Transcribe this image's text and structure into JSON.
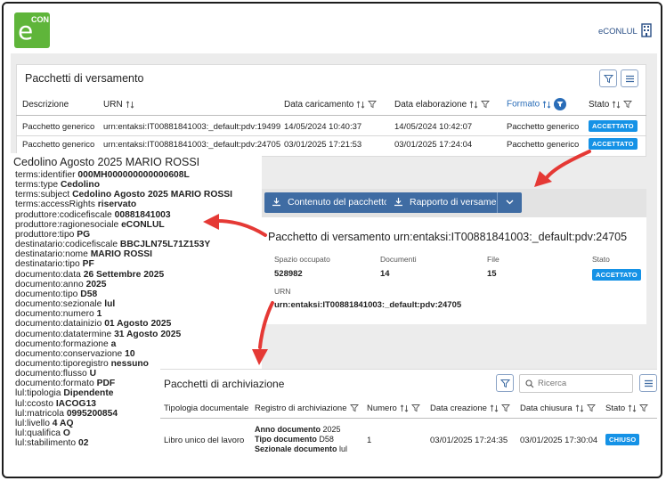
{
  "header": {
    "logo_letter": "e",
    "logo_text": "CON",
    "user": "eCONLUL"
  },
  "versamento": {
    "title": "Pacchetti di versamento",
    "columns": [
      "Descrizione",
      "URN",
      "Data caricamento",
      "Data elaborazione",
      "Formato",
      "Stato"
    ],
    "rows": [
      {
        "descrizione": "Pacchetto generico",
        "urn": "urn:entaksi:IT00881841003:_default:pdv:19499",
        "data_caricamento": "14/05/2024 10:40:37",
        "data_elaborazione": "14/05/2024 10:42:07",
        "formato": "Pacchetto generico",
        "stato": "ACCETTATO"
      },
      {
        "descrizione": "Pacchetto generico",
        "urn": "urn:entaksi:IT00881841003:_default:pdv:24705",
        "data_caricamento": "03/01/2025 17:21:53",
        "data_elaborazione": "03/01/2025 17:24:04",
        "formato": "Pacchetto generico",
        "stato": "ACCETTATO"
      }
    ]
  },
  "metadata": {
    "title": "Cedolino Agosto 2025 MARIO ROSSI",
    "lines": [
      {
        "key": "terms:identifier",
        "value": "000MH000000000000608L"
      },
      {
        "key": "terms:type",
        "value": "Cedolino"
      },
      {
        "key": "terms:subject",
        "value": "Cedolino Agosto 2025 MARIO ROSSI"
      },
      {
        "key": "terms:accessRights",
        "value": "riservato"
      },
      {
        "key": "produttore:codicefiscale",
        "value": "00881841003"
      },
      {
        "key": "produttore:ragionesociale",
        "value": "eCONLUL"
      },
      {
        "key": "produttore:tipo",
        "value": "PG"
      },
      {
        "key": "destinatario:codicefiscale",
        "value": "BBCJLN75L71Z153Y"
      },
      {
        "key": "destinatario:nome",
        "value": "MARIO ROSSI"
      },
      {
        "key": "destinatario:tipo",
        "value": "PF"
      },
      {
        "key": "documento:data",
        "value": "26 Settembre 2025"
      },
      {
        "key": "documento:anno",
        "value": "2025"
      },
      {
        "key": "documento:tipo",
        "value": "D58"
      },
      {
        "key": "documento:sezionale",
        "value": "lul"
      },
      {
        "key": "documento:numero",
        "value": "1"
      },
      {
        "key": "documento:datainizio",
        "value": "01 Agosto 2025"
      },
      {
        "key": "documento:datatermine",
        "value": "31 Agosto 2025"
      },
      {
        "key": "documento:formazione",
        "value": "a"
      },
      {
        "key": "documento:conservazione",
        "value": "10"
      },
      {
        "key": "documento:tiporegistro",
        "value": "nessuno"
      },
      {
        "key": "documento:flusso",
        "value": "U"
      },
      {
        "key": "documento:formato",
        "value": "PDF"
      },
      {
        "key": "lul:tipologia",
        "value": "Dipendente"
      },
      {
        "key": "lul:ccosto",
        "value": "IACOG13"
      },
      {
        "key": "lul:matricola",
        "value": "0995200854"
      },
      {
        "key": "lul:livello",
        "value": "4 AQ"
      },
      {
        "key": "lul:qualifica",
        "value": "O"
      },
      {
        "key": "lul:stabilimento",
        "value": "02"
      }
    ]
  },
  "detail": {
    "btn_contenuto": "Contenuto del pacchetto",
    "btn_rapporto": "Rapporto di versamento",
    "title": "Pacchetto di versamento urn:entaksi:IT00881841003:_default:pdv:24705",
    "spazio_label": "Spazio occupato",
    "spazio_value": "528982",
    "documenti_label": "Documenti",
    "documenti_value": "14",
    "file_label": "File",
    "file_value": "15",
    "stato_label": "Stato",
    "stato_value": "ACCETTATO",
    "urn_label": "URN",
    "urn_value": "urn:entaksi:IT00881841003:_default:pdv:24705"
  },
  "archiviazione": {
    "title": "Pacchetti di archiviazione",
    "search_placeholder": "Ricerca",
    "columns": [
      "Tipologia documentale",
      "Registro di archiviazione",
      "Numero",
      "Data creazione",
      "Data chiusura",
      "Stato"
    ],
    "row": {
      "tipologia": "Libro unico del lavoro",
      "anno_label": "Anno documento",
      "anno_value": "2025",
      "tipo_label": "Tipo documento",
      "tipo_value": "D58",
      "sezionale_label": "Sezionale documento",
      "sezionale_value": "lul",
      "numero": "1",
      "data_creazione": "03/01/2025 17:24:35",
      "data_chiusura": "03/01/2025 17:30:04",
      "stato": "CHIUSO"
    }
  },
  "colors": {
    "accent": "#3f6ca3",
    "badge": "#1592e6",
    "arrow": "#e53935",
    "logo": "#5fb53a"
  }
}
